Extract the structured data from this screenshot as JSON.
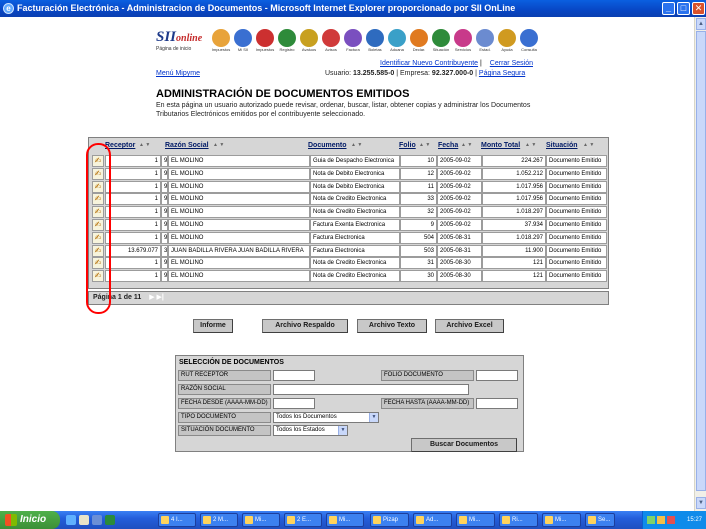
{
  "window": {
    "title": "Facturación Electrónica - Administracion de Documentos - Microsoft Internet Explorer proporcionado por SII OnLine",
    "buttons": {
      "minimize": "_",
      "maximize": "□",
      "close": "✕"
    }
  },
  "header": {
    "logo_main": "SII",
    "logo_accent": "online",
    "logo_sub": "Página de inicio",
    "nav_icons": [
      {
        "label": "Impuestos",
        "color": "#e8a33a"
      },
      {
        "label": "Mi SII",
        "color": "#3a6fd1"
      },
      {
        "label": "Impuestos",
        "color": "#cc3030"
      },
      {
        "label": "Registro",
        "color": "#2e8b3a"
      },
      {
        "label": "Avaluos",
        "color": "#c8a020"
      },
      {
        "label": "Avisos",
        "color": "#d03a3a"
      },
      {
        "label": "Factura",
        "color": "#7a4fbf"
      },
      {
        "label": "Boletas",
        "color": "#2e6bbf"
      },
      {
        "label": "Aduana",
        "color": "#3aa0c8"
      },
      {
        "label": "Declar.",
        "color": "#e07a20"
      },
      {
        "label": "Situación",
        "color": "#2e8b3a"
      },
      {
        "label": "Servicios",
        "color": "#c83a8a"
      },
      {
        "label": "Estad.",
        "color": "#6b8bd0"
      },
      {
        "label": "Ayuda",
        "color": "#d09a20"
      },
      {
        "label": "Consulta",
        "color": "#3a6fd1"
      }
    ],
    "link_identify": "Identificar Nuevo Contribuyente",
    "link_logout": "Cerrar Sesión",
    "menu_link": "Menú Mipyme",
    "user_text_label": "Usuario:",
    "user_value": "13.255.585-0",
    "company_label": "| Empresa:",
    "company_value": "92.327.000-0",
    "sep": "|",
    "secure_link": "Página Segura"
  },
  "page": {
    "title": "ADMINISTRACIÓN DE DOCUMENTOS EMITIDOS",
    "description": "En esta página un usuario autorizado puede revisar, ordenar, buscar, listar, obtener copias y administrar los Documentos Tributarios Electrónicos emitidos por el contribuyente seleccionado."
  },
  "table": {
    "headers": [
      "Receptor",
      "Razón Social",
      "Documento",
      "Folio",
      "Fecha",
      "Monto Total",
      "Situación"
    ],
    "rows": [
      {
        "rut": "1",
        "dv": "9",
        "razon": "EL MOLINO",
        "doc": "Guia de Despacho Electronica",
        "folio": "10",
        "fecha": "2005-09-02",
        "monto": "224.267",
        "sit": "Documento Emitido"
      },
      {
        "rut": "1",
        "dv": "9",
        "razon": "EL MOLINO",
        "doc": "Nota de Debito Electronica",
        "folio": "12",
        "fecha": "2005-09-02",
        "monto": "1.052.212",
        "sit": "Documento Emitido"
      },
      {
        "rut": "1",
        "dv": "9",
        "razon": "EL MOLINO",
        "doc": "Nota de Debito Electronica",
        "folio": "11",
        "fecha": "2005-09-02",
        "monto": "1.017.956",
        "sit": "Documento Emitido"
      },
      {
        "rut": "1",
        "dv": "9",
        "razon": "EL MOLINO",
        "doc": "Nota de Credito Electronica",
        "folio": "33",
        "fecha": "2005-09-02",
        "monto": "1.017.956",
        "sit": "Documento Emitido"
      },
      {
        "rut": "1",
        "dv": "9",
        "razon": "EL MOLINO",
        "doc": "Nota de Credito Electronica",
        "folio": "32",
        "fecha": "2005-09-02",
        "monto": "1.018.297",
        "sit": "Documento Emitido"
      },
      {
        "rut": "1",
        "dv": "9",
        "razon": "EL MOLINO",
        "doc": "Factura Exenta Electronica",
        "folio": "9",
        "fecha": "2005-09-02",
        "monto": "37.934",
        "sit": "Documento Emitido"
      },
      {
        "rut": "1",
        "dv": "9",
        "razon": "EL MOLINO",
        "doc": "Factura Electronica",
        "folio": "504",
        "fecha": "2005-08-31",
        "monto": "1.018.297",
        "sit": "Documento Emitido"
      },
      {
        "rut": "13.679.077",
        "dv": "3",
        "razon": "JUAN BADILLA RIVERA JUAN BADILLA RIVERA",
        "doc": "Factura Electronica",
        "folio": "503",
        "fecha": "2005-08-31",
        "monto": "11.900",
        "sit": "Documento Emitido"
      },
      {
        "rut": "1",
        "dv": "9",
        "razon": "EL MOLINO",
        "doc": "Nota de Credito Electronica",
        "folio": "31",
        "fecha": "2005-08-30",
        "monto": "121",
        "sit": "Documento Emitido"
      },
      {
        "rut": "1",
        "dv": "9",
        "razon": "EL MOLINO",
        "doc": "Nota de Credito Electronica",
        "folio": "30",
        "fecha": "2005-08-30",
        "monto": "121",
        "sit": "Documento Emitido"
      }
    ],
    "pager": "Página 1 de 11",
    "pager_next": "▶ ▶|"
  },
  "buttons": {
    "informe": "Informe",
    "respaldo": "Archivo Respaldo",
    "texto": "Archivo Texto",
    "excel": "Archivo Excel"
  },
  "selection": {
    "title": "SELECCIÓN DE DOCUMENTOS",
    "rut_label": "RUT RECEPTOR",
    "folio_label": "FOLIO DOCUMENTO",
    "razon_label": "RAZÓN SOCIAL",
    "fecha_desde_label": "FECHA DESDE (AAAA-MM-DD)",
    "fecha_hasta_label": "FECHA HASTA (AAAA-MM-DD)",
    "tipo_label": "TIPO DOCUMENTO",
    "tipo_value": "Todos los Documentos",
    "situacion_label": "SITUACIÓN DOCUMENTO",
    "situacion_value": "Todos los Estados",
    "search_button": "Buscar Documentos"
  },
  "taskbar": {
    "start": "Inicio",
    "items": [
      "4 I...",
      "2 M...",
      "Mi...",
      "2 E...",
      "Mi...",
      "Pizap",
      "Ad...",
      "Mi...",
      "Ri...",
      "Mi...",
      "Se..."
    ],
    "clock": "15:27"
  }
}
